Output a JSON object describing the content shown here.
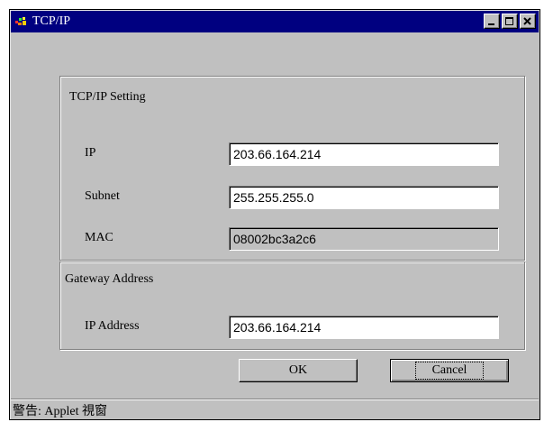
{
  "window": {
    "title": "TCP/IP",
    "icon": "java-coffee-icon",
    "controls": [
      "minimize-icon",
      "maximize-icon",
      "close-icon"
    ]
  },
  "tcpip_group": {
    "title": "TCP/IP Setting",
    "fields": {
      "ip": {
        "label": "IP",
        "value": "203.66.164.214"
      },
      "subnet": {
        "label": "Subnet",
        "value": "255.255.255.0"
      },
      "mac": {
        "label": "MAC",
        "value": "08002bc3a2c6",
        "readonly": true
      }
    }
  },
  "gateway_group": {
    "title": "Gateway Address",
    "fields": {
      "ip_address": {
        "label": "IP Address",
        "value": "203.66.164.214"
      }
    }
  },
  "buttons": {
    "ok": "OK",
    "cancel": "Cancel"
  },
  "status": {
    "text": "警告: Applet 視窗"
  },
  "colors": {
    "titlebar": "#000080",
    "face": "#c0c0c0"
  }
}
